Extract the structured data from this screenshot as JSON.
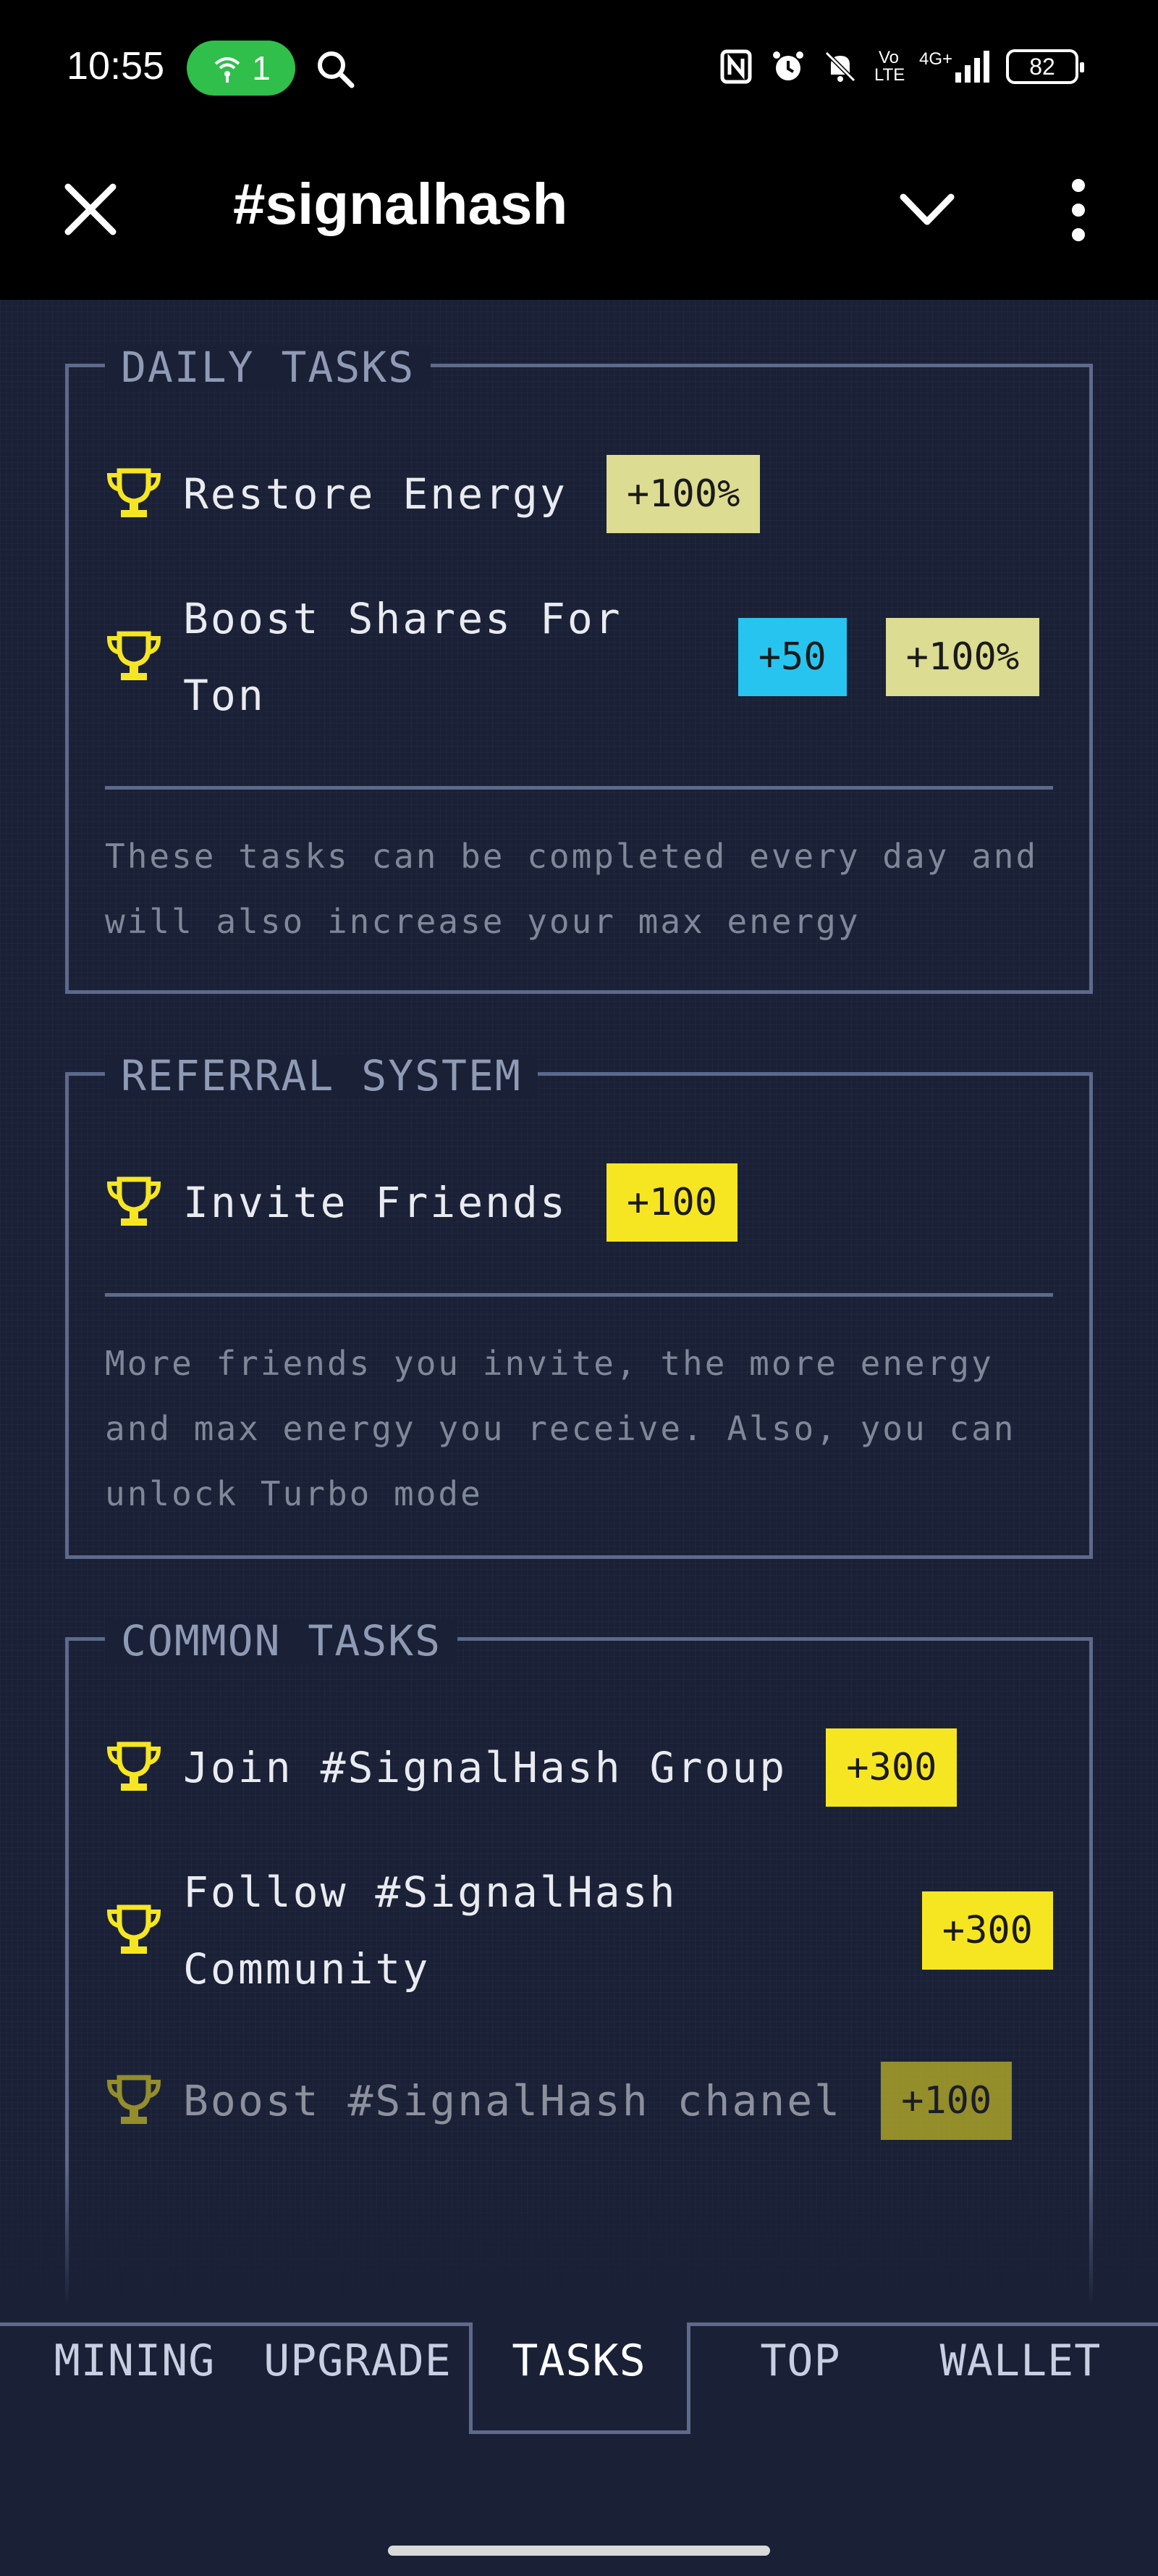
{
  "status_bar": {
    "time": "10:55",
    "hotspot_count": "1",
    "network": "4G+",
    "volte": "Vo LTE",
    "battery": "82"
  },
  "header": {
    "title": "#signalhash"
  },
  "daily_tasks": {
    "title": "DAILY TASKS",
    "tasks": [
      {
        "label": "Restore Energy",
        "rewards": [
          "+100%"
        ]
      },
      {
        "label_line1": "Boost Shares For",
        "label_line2": "Ton",
        "rewards": [
          "+50",
          "+100%"
        ]
      }
    ],
    "note_line1": "These tasks can be completed every day and",
    "note_line2": "will also increase your max energy"
  },
  "referral": {
    "title": "REFERRAL SYSTEM",
    "tasks": [
      {
        "label": "Invite Friends",
        "rewards": [
          "+100"
        ]
      }
    ],
    "note_line1": "More friends you invite, the more energy",
    "note_line2": "and max energy you receive. Also, you can",
    "note_line3": "unlock Turbo mode"
  },
  "common_tasks": {
    "title": "COMMON TASKS",
    "tasks": [
      {
        "label": "Join #SignalHash Group",
        "rewards": [
          "+300"
        ]
      },
      {
        "label_line1": "Follow #SignalHash",
        "label_line2": "Community",
        "rewards": [
          "+300"
        ]
      },
      {
        "label": "Boost #SignalHash chanel",
        "rewards": [
          "+100"
        ]
      }
    ]
  },
  "nav": {
    "tabs": [
      "MINING",
      "UPGRADE",
      "TASKS",
      "TOP",
      "WALLET"
    ],
    "active": "TASKS"
  },
  "colors": {
    "background": "#1a2136",
    "border": "#5d6a8c",
    "badge_yellow": "#f6e622",
    "badge_pale": "#dcdc92",
    "badge_cyan": "#27c4ef",
    "trophy": "#f6e622",
    "hotspot": "#2fbf4a"
  }
}
